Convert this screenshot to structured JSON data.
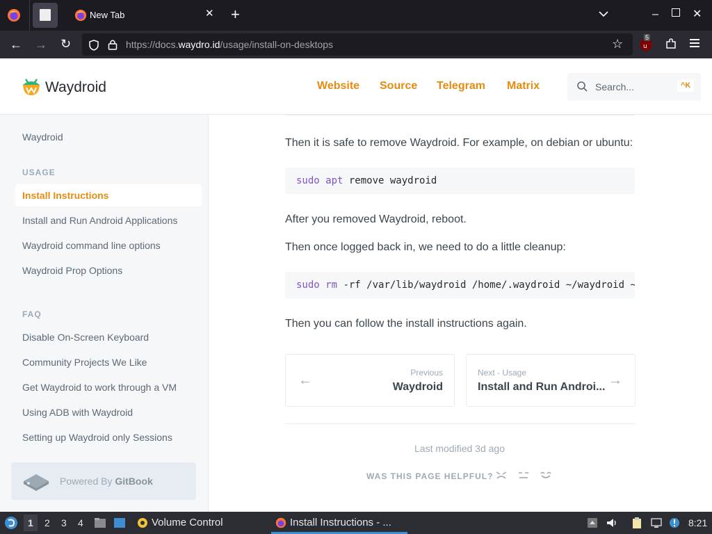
{
  "browser": {
    "tabs": [
      {
        "label": "New Tab"
      }
    ],
    "url_prefix": "https://docs.",
    "url_domain": "waydro.id",
    "url_path": "/usage/install-on-desktops",
    "ublock_badge": "5"
  },
  "site": {
    "logo_text": "Waydroid",
    "nav": [
      "Website",
      "Source",
      "Telegram",
      "Matrix"
    ],
    "search_placeholder": "Search...",
    "search_shortcut": "^K"
  },
  "sidebar": {
    "top_item": "Waydroid",
    "usage_heading": "USAGE",
    "usage_items": [
      "Install Instructions",
      "Install and Run Android Applications",
      "Waydroid command line options",
      "Waydroid Prop Options"
    ],
    "faq_heading": "FAQ",
    "faq_items": [
      "Disable On-Screen Keyboard",
      "Community Projects We Like",
      "Get Waydroid to work through a VM",
      "Using ADB with Waydroid",
      "Setting up Waydroid only Sessions"
    ],
    "powered_by": "Powered By ",
    "powered_brand": "GitBook"
  },
  "content": {
    "p1": "Then it is safe to remove Waydroid. For example, on debian or ubuntu:",
    "code1": {
      "kw1": "sudo",
      "kw2": "apt",
      "rest": " remove waydroid"
    },
    "p2": "After you removed Waydroid, reboot.",
    "p3": "Then once logged back in, we need to do a little cleanup:",
    "code2": {
      "kw1": "sudo",
      "kw2": "rm",
      "rest": " -rf /var/lib/waydroid /home/.waydroid ~/waydroid ~/.share"
    },
    "p4": "Then you can follow the install instructions again.",
    "prev_small": "Previous",
    "prev_title": "Waydroid",
    "next_small": "Next - Usage",
    "next_title": "Install and Run Androi...",
    "last_modified": "Last modified 3d ago",
    "helpful": "WAS THIS PAGE HELPFUL?"
  },
  "taskbar": {
    "workspaces": [
      "1",
      "2",
      "3",
      "4"
    ],
    "task1": "Volume Control",
    "task2": "Install Instructions - ...",
    "clock": "8:21"
  }
}
